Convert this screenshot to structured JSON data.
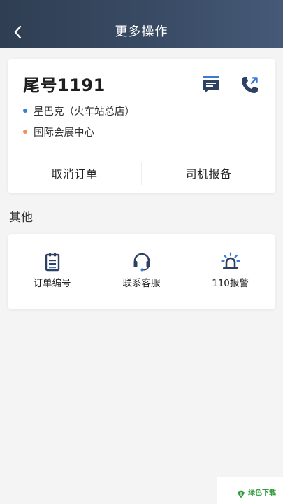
{
  "header": {
    "title": "更多操作"
  },
  "order": {
    "plate": "尾号1191",
    "start_location": "星巴克（火车站总店）",
    "end_location": "国际会展中心",
    "start_dot_color": "#3a7bd5",
    "end_dot_color": "#f0915a",
    "cancel_label": "取消订单",
    "report_label": "司机报备"
  },
  "other": {
    "title": "其他",
    "tools": [
      {
        "label": "订单编号",
        "icon": "clipboard-icon"
      },
      {
        "label": "联系客服",
        "icon": "headset-icon"
      },
      {
        "label": "110报警",
        "icon": "siren-icon"
      }
    ]
  },
  "watermark": {
    "text": "绿色下载"
  },
  "colors": {
    "header_bg": "#34455d",
    "icon_primary": "#2f4160",
    "icon_accent": "#3a7bd5"
  }
}
